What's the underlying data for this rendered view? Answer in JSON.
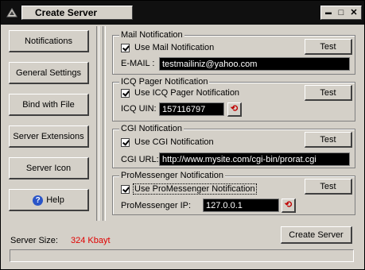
{
  "window": {
    "title": "Create Server",
    "minimize_glyph": "▬",
    "maximize_glyph": "□",
    "close_glyph": "✕"
  },
  "nav": {
    "notifications": "Notifications",
    "general_settings": "General Settings",
    "bind_with_file": "Bind with File",
    "server_extensions": "Server Extensions",
    "server_icon": "Server Icon",
    "help": "Help",
    "help_glyph": "?"
  },
  "mail": {
    "group_title": "Mail Notification",
    "checkbox_label": "Use Mail Notification",
    "checked": true,
    "field_label": "E-MAIL :",
    "value": "testmailiniz@yahoo.com",
    "test_label": "Test"
  },
  "icq": {
    "group_title": "ICQ Pager Notification",
    "checkbox_label": "Use ICQ Pager Notification",
    "checked": true,
    "field_label": "ICQ UIN:",
    "value": "157116797",
    "test_label": "Test",
    "reset_glyph": "⟲"
  },
  "cgi": {
    "group_title": "CGI Notification",
    "checkbox_label": "Use CGI Notification",
    "checked": true,
    "field_label": "CGI URL:",
    "value": "http://www.mysite.com/cgi-bin/prorat.cgi",
    "test_label": "Test"
  },
  "promessenger": {
    "group_title": "ProMessenger Notification",
    "checkbox_label": "Use ProMessenger Notification",
    "checked": true,
    "field_label": "ProMessenger IP:",
    "value": "127.0.0.1",
    "test_label": "Test",
    "reset_glyph": "⟲"
  },
  "footer": {
    "server_size_label": "Server Size:",
    "server_size_value": "324 Kbayt",
    "create_label": "Create Server",
    "progress": 0
  },
  "colors": {
    "accent_red": "#e00000",
    "field_bg": "#000000",
    "window_bg": "#d4d0c8"
  }
}
